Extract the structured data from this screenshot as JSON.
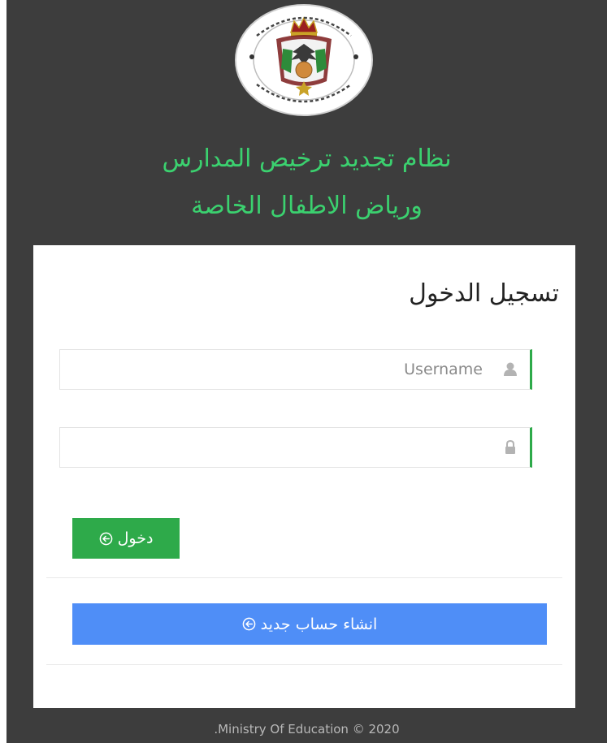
{
  "header": {
    "title_line_1": "نظام تجديد ترخيص المدارس",
    "title_line_2": "ورياض الاطفال الخاصة",
    "emblem_icon": "ministry-seal-icon",
    "emblem_text": "المملكة الأردنية الهاشمية - وزارة التربية والتعليم"
  },
  "login": {
    "heading": "تسجيل الدخول",
    "username": {
      "placeholder": "Username",
      "value": "",
      "icon": "user-icon"
    },
    "password": {
      "placeholder": "",
      "value": "",
      "icon": "lock-icon"
    },
    "login_button_label": "دخول",
    "login_button_icon": "circle-arrow-left-icon",
    "register_button_label": "انشاء حساب جديد",
    "register_button_icon": "circle-arrow-left-icon"
  },
  "footer": {
    "copyright": ".Ministry Of Education © 2020"
  },
  "colors": {
    "background": "#3d3d3d",
    "title_green": "#3bd16f",
    "login_button": "#2eaa4a",
    "register_button": "#4f8ef7",
    "input_accent": "#2eaa4a"
  }
}
